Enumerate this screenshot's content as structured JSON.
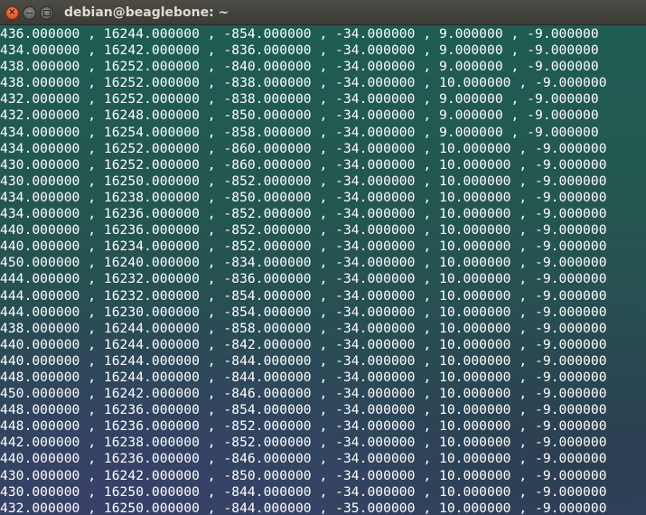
{
  "window": {
    "title": "debian@beaglebone: ~",
    "buttons": {
      "close": "×",
      "minimize": "–",
      "maximize": "□"
    }
  },
  "terminal": {
    "lines": [
      "436.000000 , 16244.000000 , -854.000000 , -34.000000 , 9.000000 , -9.000000",
      "434.000000 , 16242.000000 , -836.000000 , -34.000000 , 9.000000 , -9.000000",
      "438.000000 , 16252.000000 , -840.000000 , -34.000000 , 9.000000 , -9.000000",
      "438.000000 , 16252.000000 , -838.000000 , -34.000000 , 10.000000 , -9.000000",
      "432.000000 , 16252.000000 , -838.000000 , -34.000000 , 9.000000 , -9.000000",
      "432.000000 , 16248.000000 , -850.000000 , -34.000000 , 9.000000 , -9.000000",
      "434.000000 , 16254.000000 , -858.000000 , -34.000000 , 9.000000 , -9.000000",
      "434.000000 , 16252.000000 , -860.000000 , -34.000000 , 10.000000 , -9.000000",
      "430.000000 , 16252.000000 , -860.000000 , -34.000000 , 10.000000 , -9.000000",
      "430.000000 , 16250.000000 , -852.000000 , -34.000000 , 10.000000 , -9.000000",
      "434.000000 , 16238.000000 , -850.000000 , -34.000000 , 10.000000 , -9.000000",
      "434.000000 , 16236.000000 , -852.000000 , -34.000000 , 10.000000 , -9.000000",
      "440.000000 , 16236.000000 , -852.000000 , -34.000000 , 10.000000 , -9.000000",
      "440.000000 , 16234.000000 , -852.000000 , -34.000000 , 10.000000 , -9.000000",
      "450.000000 , 16240.000000 , -834.000000 , -34.000000 , 10.000000 , -9.000000",
      "444.000000 , 16232.000000 , -836.000000 , -34.000000 , 10.000000 , -9.000000",
      "444.000000 , 16232.000000 , -854.000000 , -34.000000 , 10.000000 , -9.000000",
      "444.000000 , 16230.000000 , -854.000000 , -34.000000 , 10.000000 , -9.000000",
      "438.000000 , 16244.000000 , -858.000000 , -34.000000 , 10.000000 , -9.000000",
      "440.000000 , 16244.000000 , -842.000000 , -34.000000 , 10.000000 , -9.000000",
      "440.000000 , 16244.000000 , -844.000000 , -34.000000 , 10.000000 , -9.000000",
      "448.000000 , 16244.000000 , -844.000000 , -34.000000 , 10.000000 , -9.000000",
      "450.000000 , 16242.000000 , -846.000000 , -34.000000 , 10.000000 , -9.000000",
      "448.000000 , 16236.000000 , -854.000000 , -34.000000 , 10.000000 , -9.000000",
      "448.000000 , 16236.000000 , -852.000000 , -34.000000 , 10.000000 , -9.000000",
      "442.000000 , 16238.000000 , -852.000000 , -34.000000 , 10.000000 , -9.000000",
      "440.000000 , 16236.000000 , -846.000000 , -34.000000 , 10.000000 , -9.000000",
      "430.000000 , 16242.000000 , -850.000000 , -34.000000 , 10.000000 , -9.000000",
      "430.000000 , 16250.000000 , -844.000000 , -34.000000 , 10.000000 , -9.000000",
      "432.000000 , 16250.000000 , -844.000000 , -35.000000 , 10.000000 , -9.000000"
    ]
  },
  "colors": {
    "terminal_text": "#ffffff",
    "title_bar": "#3c3b37",
    "title_text": "#dfdbd2",
    "close_button": "#e0531d",
    "terminal_bg_top": "#1f5c53",
    "terminal_bg_bottom": "#334462"
  }
}
